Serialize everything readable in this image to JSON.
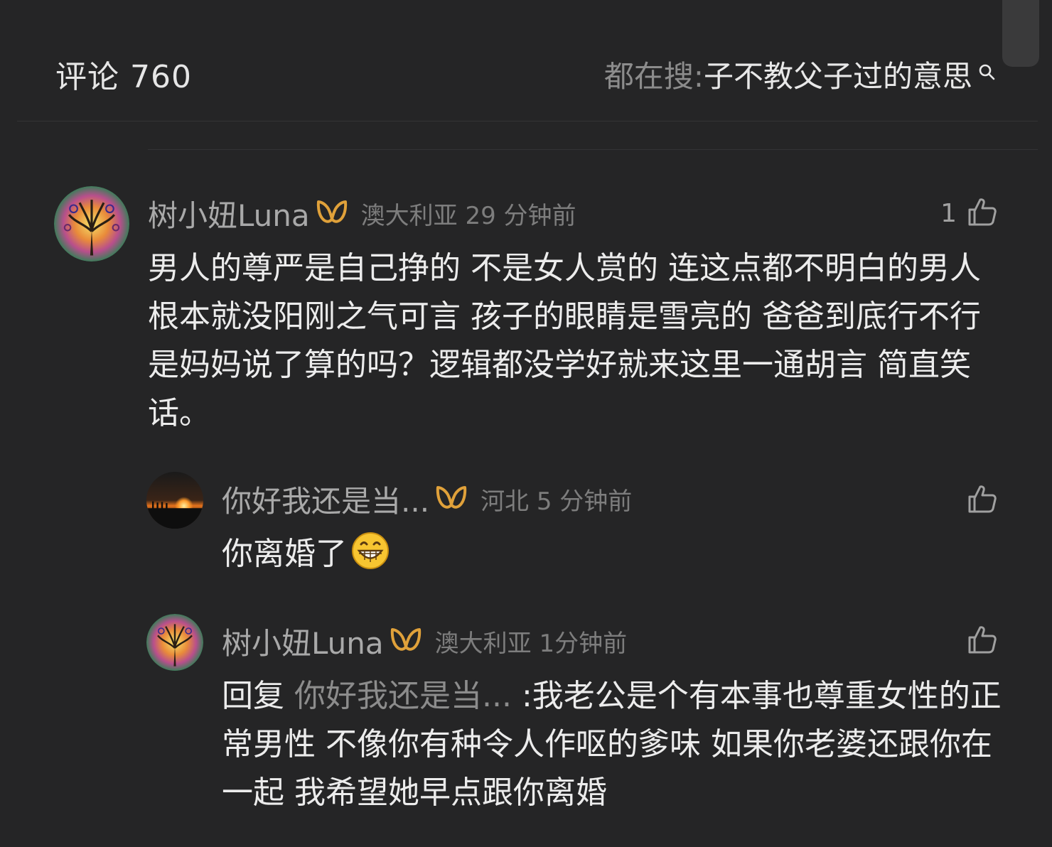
{
  "header": {
    "comment_count_label": "评论 760",
    "hot_search_label": "都在搜:",
    "hot_search_query": "子不教父子过的意思"
  },
  "comments": [
    {
      "username": "树小妞Luna",
      "location_time": "澳大利亚 29 分钟前",
      "likes": "1",
      "text": "男人的尊严是自己挣的 不是女人赏的 连这点都不明白的男人根本就没阳刚之气可言 孩子的眼睛是雪亮的 爸爸到底行不行是妈妈说了算的吗？逻辑都没学好就来这里一通胡言 简直笑话。",
      "avatar": "tree-avatar"
    }
  ],
  "replies": [
    {
      "username": "你好我还是当...",
      "location_time": "河北 5 分钟前",
      "text": "你离婚了",
      "emoji": "grinning-face",
      "avatar": "sunset-avatar"
    },
    {
      "username": "树小妞Luna",
      "location_time": "澳大利亚 1分钟前",
      "reply_prefix": "回复 ",
      "reply_target": "你好我还是当...",
      "text": " :我老公是个有本事也尊重女性的正常男性 不像你有种令人作呕的爹味 如果你老婆还跟你在一起 我希望她早点跟你离婚",
      "avatar": "tree-avatar"
    }
  ],
  "colors": {
    "background": "#252526",
    "badge": "#e0a13a",
    "text": "#ececec",
    "muted": "#7d7d7d"
  }
}
